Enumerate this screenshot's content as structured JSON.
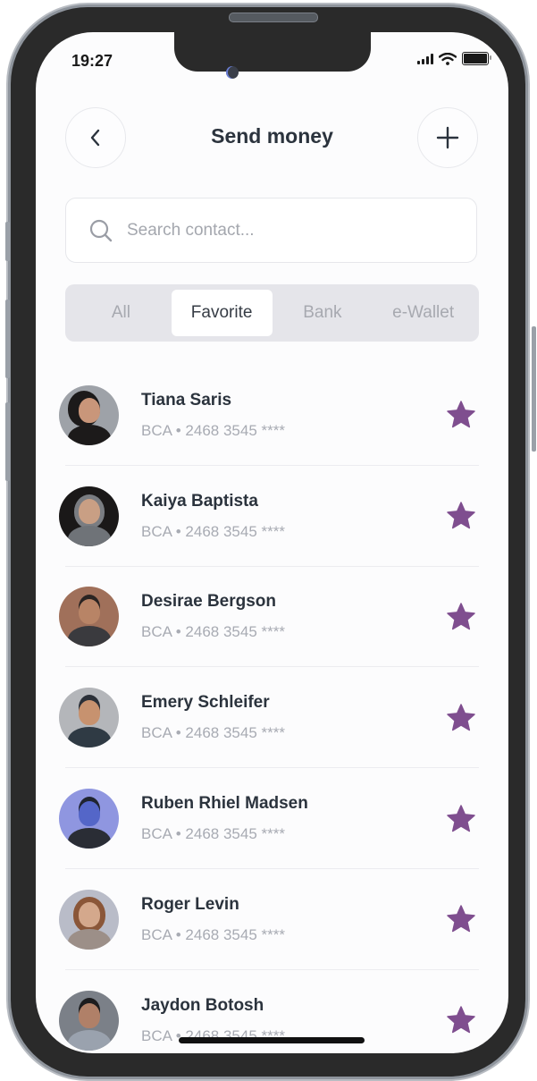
{
  "status_bar": {
    "time": "19:27"
  },
  "header": {
    "title": "Send money",
    "back_icon": "chevron-left-icon",
    "add_icon": "plus-icon"
  },
  "search": {
    "placeholder": "Search contact...",
    "value": "",
    "icon": "search-icon"
  },
  "tabs": [
    {
      "label": "All",
      "active": false
    },
    {
      "label": "Favorite",
      "active": true
    },
    {
      "label": "Bank",
      "active": false
    },
    {
      "label": "e-Wallet",
      "active": false
    }
  ],
  "colors": {
    "accent_star": "#7f4e8f",
    "title": "#2b333d",
    "muted": "#a8abb3"
  },
  "contacts": [
    {
      "name": "Tiana Saris",
      "account": "BCA • 2468 3545 ****",
      "favorite": true
    },
    {
      "name": "Kaiya Baptista",
      "account": "BCA • 2468 3545 ****",
      "favorite": true
    },
    {
      "name": "Desirae Bergson",
      "account": "BCA • 2468 3545 ****",
      "favorite": true
    },
    {
      "name": "Emery Schleifer",
      "account": "BCA • 2468 3545 ****",
      "favorite": true
    },
    {
      "name": "Ruben Rhiel Madsen",
      "account": "BCA • 2468 3545 ****",
      "favorite": true
    },
    {
      "name": "Roger Levin",
      "account": "BCA • 2468 3545 ****",
      "favorite": true
    },
    {
      "name": "Jaydon Botosh",
      "account": "BCA • 2468 3545 ****",
      "favorite": true
    }
  ]
}
